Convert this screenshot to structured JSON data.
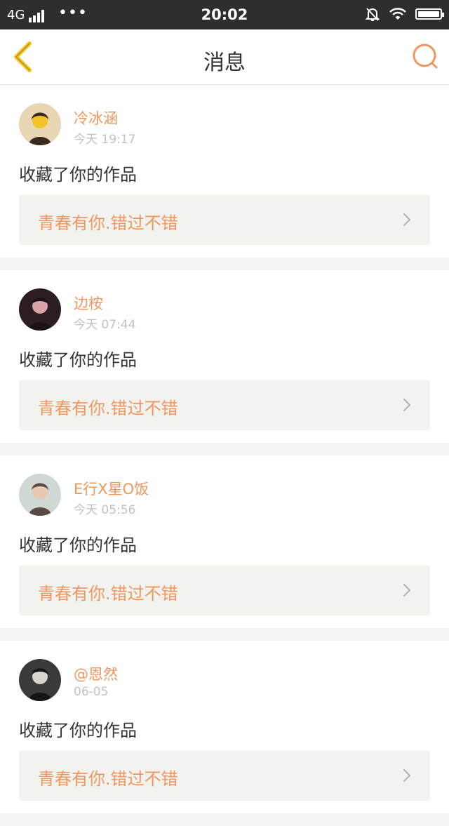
{
  "status_bar": {
    "network": "4G",
    "dots": "•••",
    "time": "20:02",
    "battery_level": 1.0
  },
  "header": {
    "title": "消息",
    "accent_color": "#f0975e",
    "back_icon": "chevron-left-icon",
    "search_icon": "search-icon"
  },
  "notifications": [
    {
      "user": "冷冰涵",
      "time": "今天 19:17",
      "action": "收藏了你的作品",
      "work_title": "青春有你.错过不错",
      "avatar_colors": [
        "#e8d6b4",
        "#f2c227",
        "#3a2a1e"
      ]
    },
    {
      "user": "边桉",
      "time": "今天 07:44",
      "action": "收藏了你的作品",
      "work_title": "青春有你.错过不错",
      "avatar_colors": [
        "#2b1d22",
        "#d9a3a8",
        "#1b1216"
      ]
    },
    {
      "user": "E行X星O饭",
      "time": "今天 05:56",
      "action": "收藏了你的作品",
      "work_title": "青春有你.错过不错",
      "avatar_colors": [
        "#cfd8d2",
        "#e8c8b2",
        "#5a4a44"
      ]
    },
    {
      "user": "@恩然",
      "time": "06-05",
      "action": "收藏了你的作品",
      "work_title": "青春有你.错过不错",
      "avatar_colors": [
        "#3a3a3a",
        "#d9d3cc",
        "#151515"
      ]
    }
  ]
}
